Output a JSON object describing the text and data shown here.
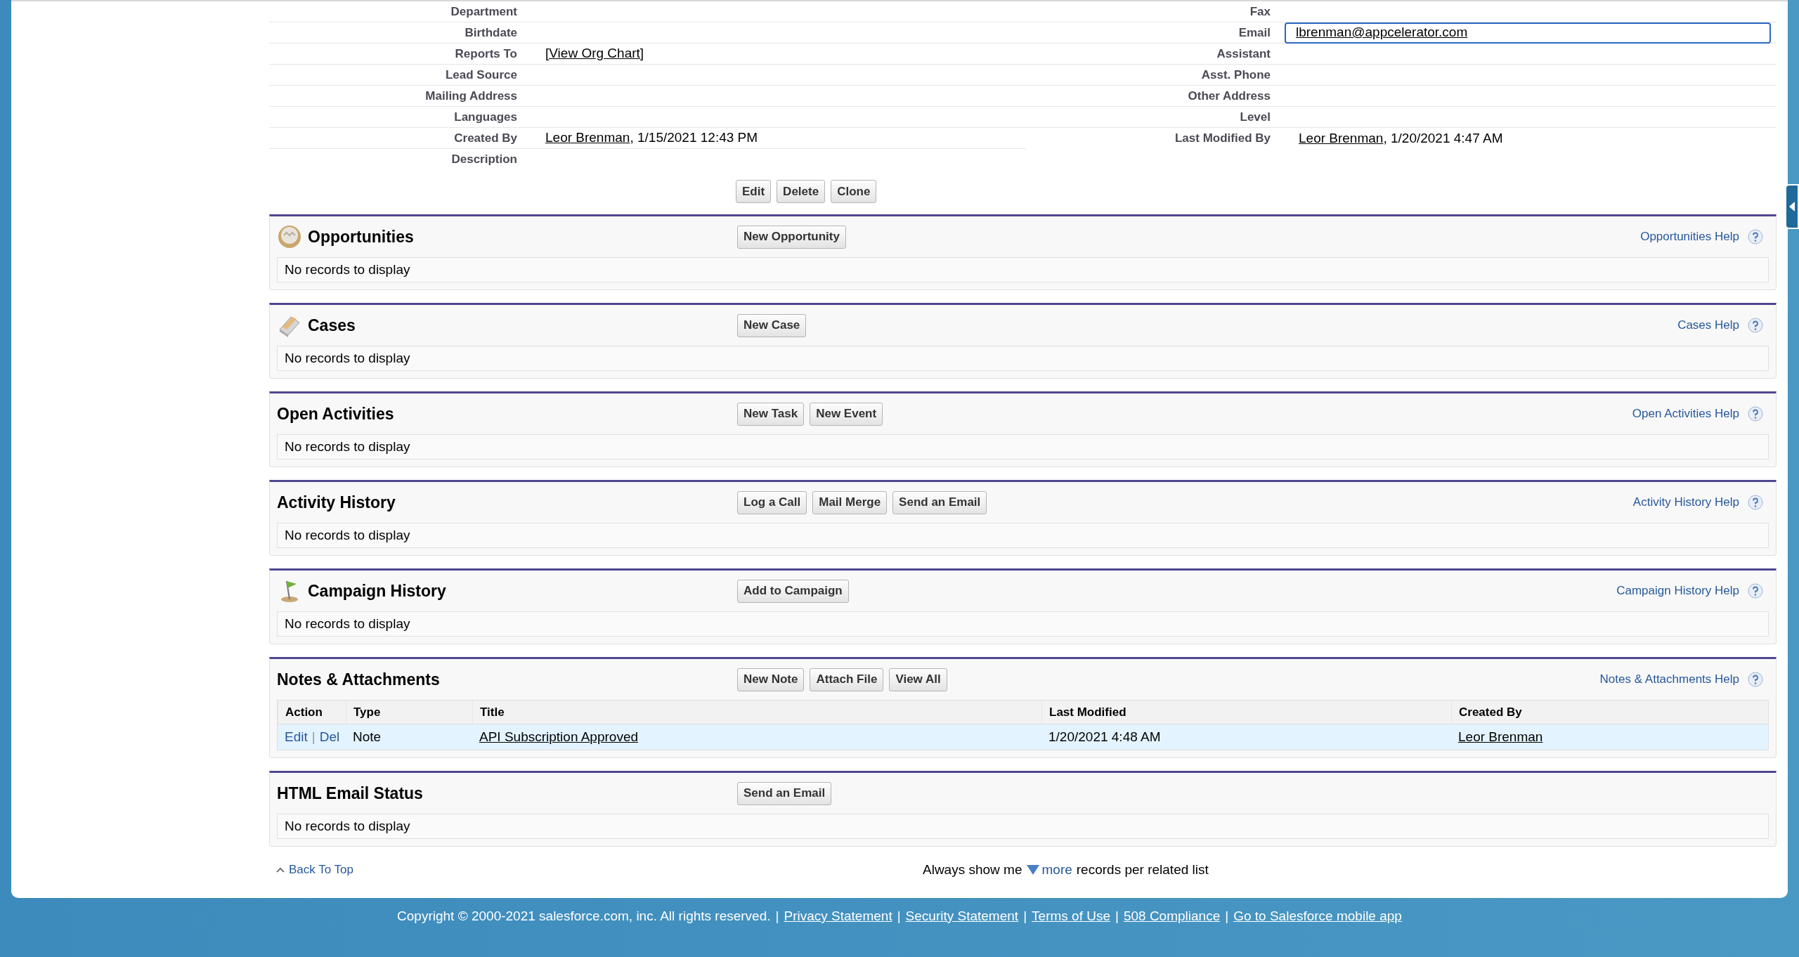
{
  "details": {
    "rows": [
      {
        "left": {
          "label": "Department"
        },
        "right": {
          "label": "Fax"
        }
      },
      {
        "left": {
          "label": "Birthdate"
        },
        "right": {
          "label": "Email",
          "kind": "boxed",
          "value": [
            {
              "kind": "link",
              "text": "lbrenman@appcelerator.com"
            }
          ]
        }
      },
      {
        "left": {
          "label": "Reports To",
          "kind": "plain",
          "value": [
            {
              "kind": "link",
              "text": "[View Org Chart]"
            }
          ]
        },
        "right": {
          "label": "Assistant"
        }
      },
      {
        "left": {
          "label": "Lead Source"
        },
        "right": {
          "label": "Asst. Phone"
        }
      },
      {
        "left": {
          "label": "Mailing Address"
        },
        "right": {
          "label": "Other Address"
        }
      },
      {
        "left": {
          "label": "Languages"
        },
        "right": {
          "label": "Level"
        }
      },
      {
        "left": {
          "label": "Created By",
          "kind": "plain",
          "value": [
            {
              "kind": "link",
              "text": "Leor Brenman"
            },
            {
              "kind": "text",
              "text": ", 1/15/2021 12:43 PM"
            }
          ]
        },
        "right": {
          "label": "Last Modified By",
          "kind": "plain",
          "value": [
            {
              "kind": "link",
              "text": "Leor Brenman"
            },
            {
              "kind": "text",
              "text": ", 1/20/2021 4:47 AM"
            }
          ]
        }
      },
      {
        "left": {
          "label": "Description"
        }
      }
    ],
    "buttons": [
      "Edit",
      "Delete",
      "Clone"
    ]
  },
  "sections": [
    {
      "title": "Opportunities",
      "buttons": [
        "New Opportunity"
      ],
      "help": "Opportunities Help",
      "empty": "No records to display"
    },
    {
      "title": "Cases",
      "buttons": [
        "New Case"
      ],
      "help": "Cases Help",
      "empty": "No records to display"
    },
    {
      "title": "Open Activities",
      "buttons": [
        "New Task",
        "New Event"
      ],
      "help": "Open Activities Help",
      "empty": "No records to display"
    },
    {
      "title": "Activity History",
      "buttons": [
        "Log a Call",
        "Mail Merge",
        "Send an Email"
      ],
      "help": "Activity History Help",
      "empty": "No records to display"
    },
    {
      "title": "Campaign History",
      "buttons": [
        "Add to Campaign"
      ],
      "help": "Campaign History Help",
      "empty": "No records to display"
    },
    {
      "title": "Notes & Attachments",
      "buttons": [
        "New Note",
        "Attach File",
        "View All"
      ],
      "help": "Notes & Attachments Help",
      "table": {
        "columns": [
          "Action",
          "Type",
          "Title",
          "Last Modified",
          "Created By"
        ],
        "rows": [
          {
            "highlighted": true,
            "cells": [
              {
                "kind": "actions",
                "parts": [
                  "Edit",
                  "|",
                  "Del"
                ]
              },
              {
                "kind": "text",
                "text": "Note"
              },
              {
                "kind": "link",
                "text": "API Subscription Approved"
              },
              {
                "kind": "text",
                "text": "1/20/2021 4:48 AM"
              },
              {
                "kind": "link",
                "text": "Leor Brenman"
              }
            ]
          }
        ]
      }
    },
    {
      "title": "HTML Email Status",
      "buttons": [
        "Send an Email"
      ],
      "empty": "No records to display"
    }
  ],
  "back_to_top": "Back To Top",
  "records_per_list": {
    "before": "Always show me",
    "link": "more",
    "after": "records per related list"
  },
  "footer": {
    "separator": "|",
    "items": [
      {
        "kind": "text",
        "text": "Copyright © 2000-2021 salesforce.com, inc. All rights reserved."
      },
      {
        "kind": "link",
        "text": "Privacy Statement"
      },
      {
        "kind": "link",
        "text": "Security Statement"
      },
      {
        "kind": "link",
        "text": "Terms of Use"
      },
      {
        "kind": "link",
        "text": "508 Compliance"
      },
      {
        "kind": "link",
        "text": "Go to Salesforce mobile app"
      }
    ]
  }
}
